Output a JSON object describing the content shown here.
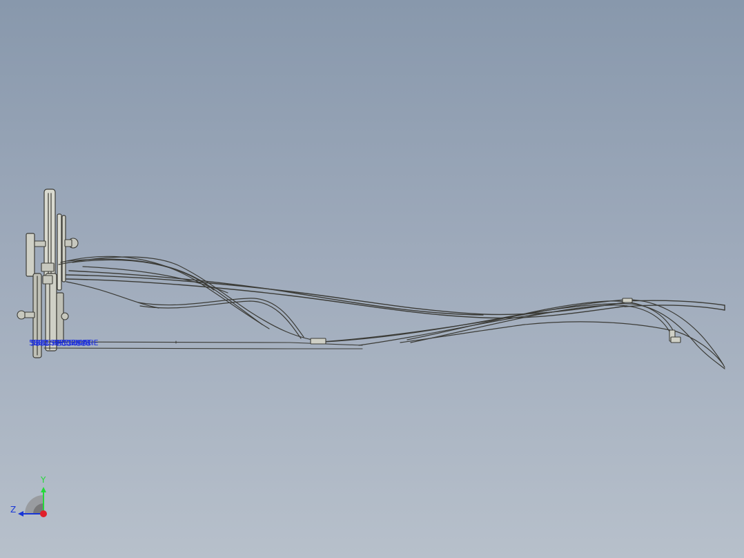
{
  "viewport": {
    "background_top": "#8898ac",
    "background_bottom": "#b7c0cb"
  },
  "model": {
    "name": "wire-harness-assembly",
    "line_color": "#3b3b36",
    "fill_color": "#cfd0c6"
  },
  "annotations": [
    "5802 SPECIFICATIE",
    "5801 SPEC2045",
    "5802-SPEC0456",
    "5802-PECO4586"
  ],
  "triad": {
    "y_label": "Y",
    "z_label": "Z",
    "y_color": "#25d93a",
    "z_color": "#1735d6",
    "x_color": "#e0202a"
  }
}
